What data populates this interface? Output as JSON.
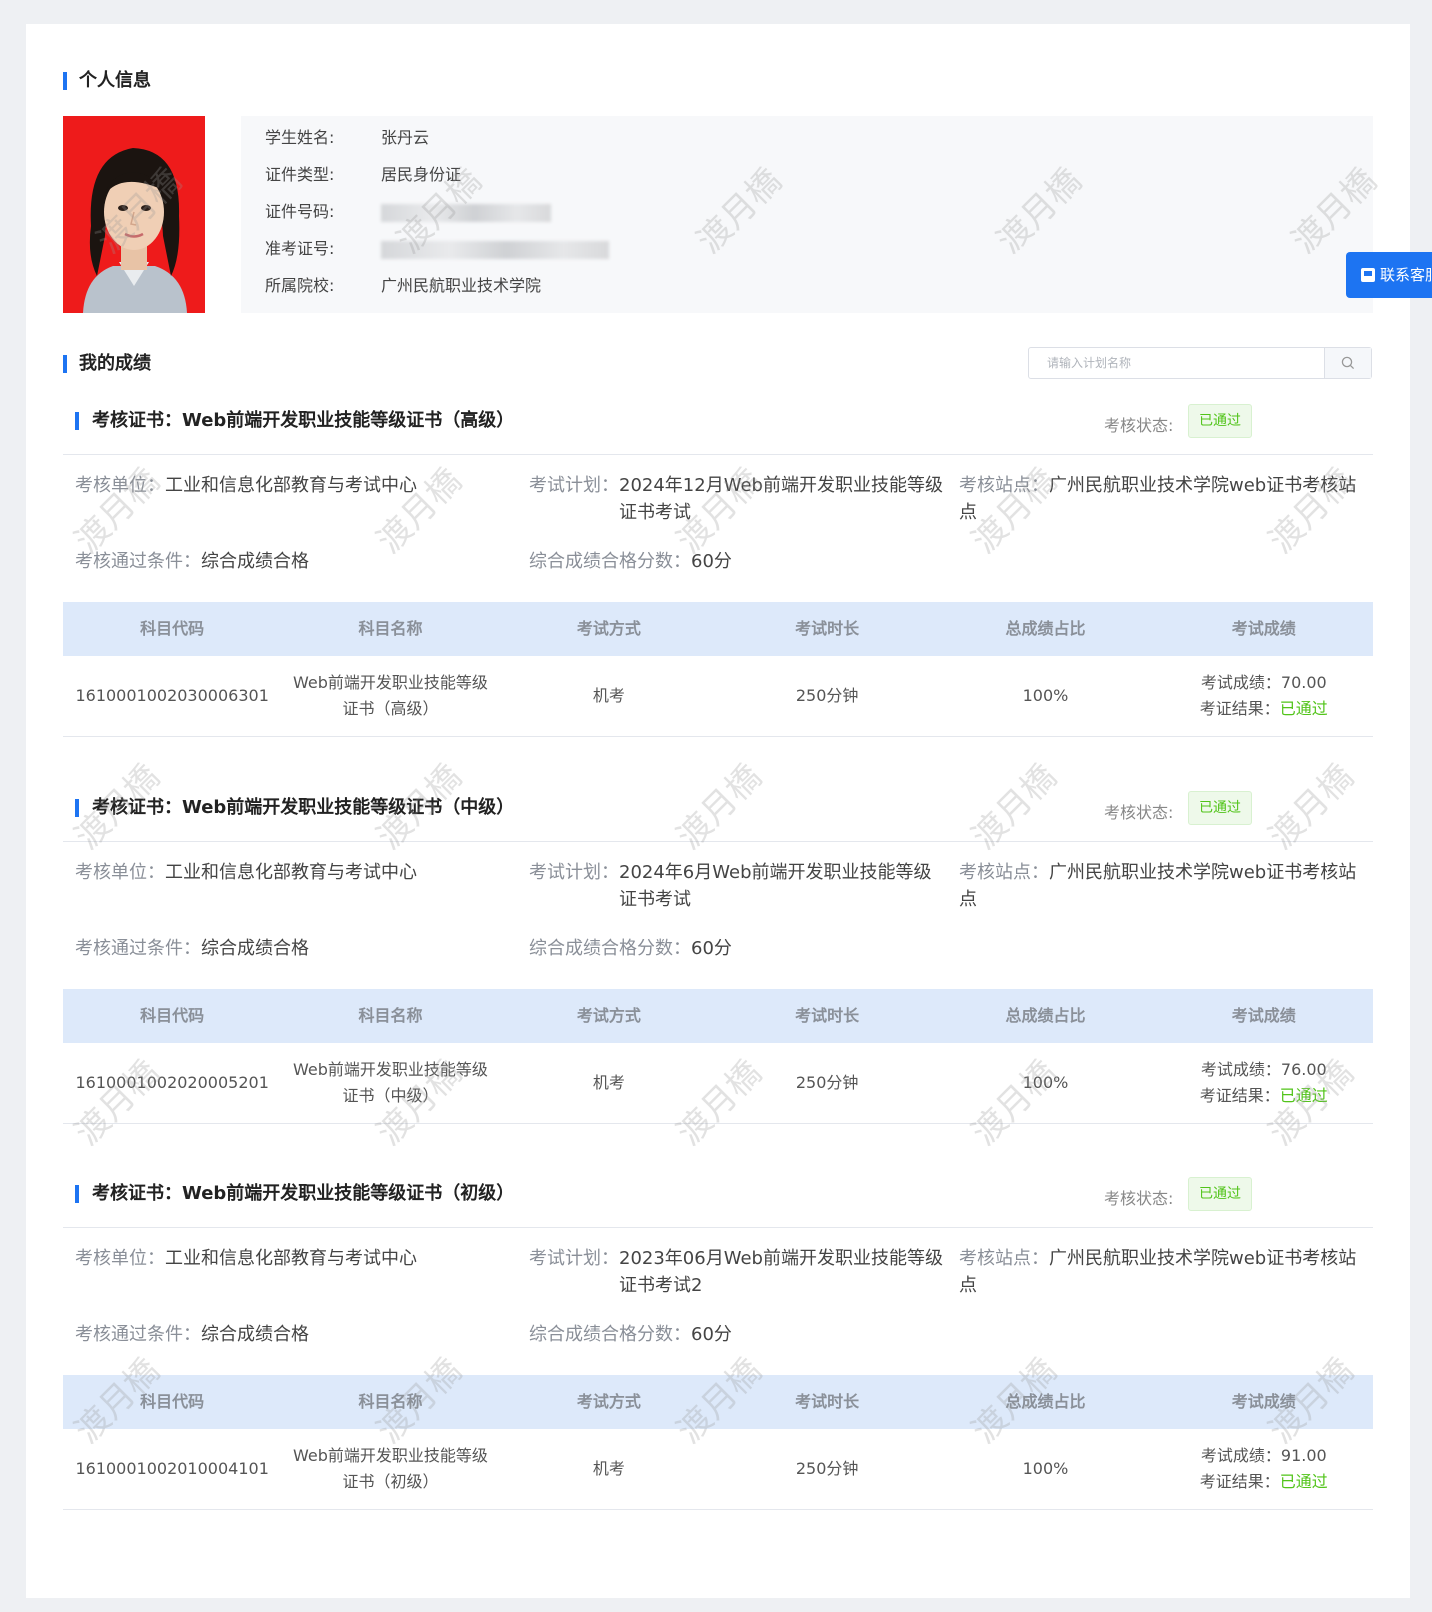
{
  "personal": {
    "title": "个人信息",
    "rows": [
      {
        "label": "学生姓名:",
        "value": "张丹云"
      },
      {
        "label": "证件类型:",
        "value": "居民身份证"
      },
      {
        "label": "证件号码:",
        "value": ""
      },
      {
        "label": "准考证号:",
        "value": ""
      },
      {
        "label": "所属院校:",
        "value": "广州民航职业技术学院"
      }
    ]
  },
  "scores": {
    "title": "我的成绩",
    "search_placeholder": "请输入计划名称"
  },
  "contact_label": "联系客服",
  "table_headers": [
    "科目代码",
    "科目名称",
    "考试方式",
    "考试时长",
    "总成绩占比",
    "考试成绩"
  ],
  "labels": {
    "status": "考核状态:",
    "unit": "考核单位：",
    "plan": "考试计划：",
    "site": "考核站点：",
    "cond": "考核通过条件：",
    "pass_score": "综合成绩合格分数：",
    "exam_score": "考试成绩：",
    "cert_result": "考证结果："
  },
  "certs": [
    {
      "title": "考核证书：Web前端开发职业技能等级证书（高级）",
      "status": "已通过",
      "unit": "工业和信息化部教育与考试中心",
      "plan": "2024年12月Web前端开发职业技能等级证书考试",
      "site": "广州民航职业技术学院web证书考核站点",
      "cond": "综合成绩合格",
      "pass_score": "60分",
      "row": {
        "code": "1610001002030006301",
        "name_line1": "Web前端开发职业技能等级",
        "name_line2": "证书（高级）",
        "method": "机考",
        "duration": "250分钟",
        "ratio": "100%",
        "score": "70.00",
        "result": "已通过"
      }
    },
    {
      "title": "考核证书：Web前端开发职业技能等级证书（中级）",
      "status": "已通过",
      "unit": "工业和信息化部教育与考试中心",
      "plan": "2024年6月Web前端开发职业技能等级证书考试",
      "site": "广州民航职业技术学院web证书考核站点",
      "cond": "综合成绩合格",
      "pass_score": "60分",
      "row": {
        "code": "1610001002020005201",
        "name_line1": "Web前端开发职业技能等级",
        "name_line2": "证书（中级）",
        "method": "机考",
        "duration": "250分钟",
        "ratio": "100%",
        "score": "76.00",
        "result": "已通过"
      }
    },
    {
      "title": "考核证书：Web前端开发职业技能等级证书（初级）",
      "status": "已通过",
      "unit": "工业和信息化部教育与考试中心",
      "plan": "2023年06月Web前端开发职业技能等级证书考试2",
      "site": "广州民航职业技术学院web证书考核站点",
      "cond": "综合成绩合格",
      "pass_score": "60分",
      "row": {
        "code": "1610001002010004101",
        "name_line1": "Web前端开发职业技能等级",
        "name_line2": "证书（初级）",
        "method": "机考",
        "duration": "250分钟",
        "ratio": "100%",
        "score": "91.00",
        "result": "已通过"
      }
    }
  ],
  "watermark": "渡月橋",
  "colors": {
    "accent": "#1d74f2",
    "pass": "#52c41a",
    "header_bg": "#dde9fa",
    "photo_bg": "#ee1b1b"
  }
}
